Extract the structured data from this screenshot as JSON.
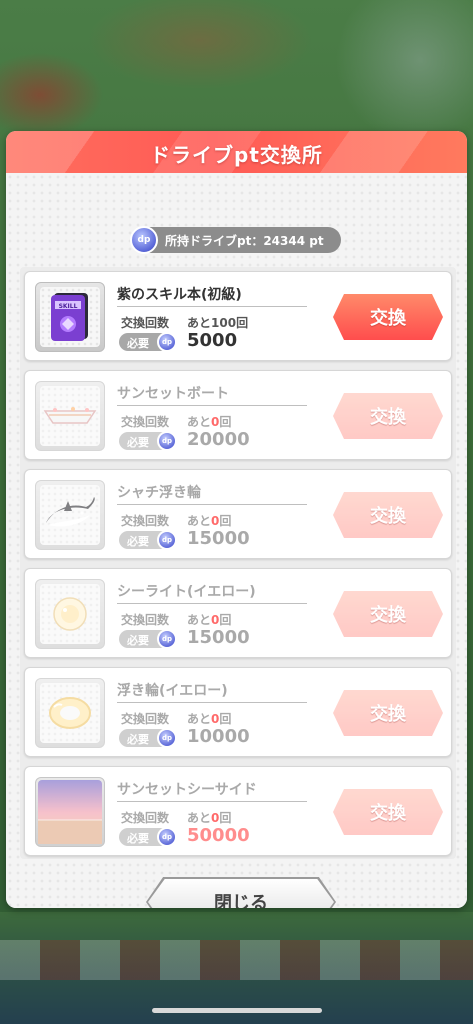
{
  "modal": {
    "title": "ドライブpt交換所",
    "points_label": "所持ドライブpt：24344 pt",
    "close_label": "閉じる"
  },
  "common": {
    "count_label": "交換回数",
    "required_label": "必要",
    "exchange_label": "交換",
    "coin_icon_text": "dp"
  },
  "items": [
    {
      "name": "紫のスキル本(初級)",
      "remaining_prefix": "あと",
      "remaining_num": "100",
      "remaining_suffix": "回",
      "cost": "5000",
      "icon": "purple-skill-book-icon",
      "enabled": true
    },
    {
      "name": "サンセットボート",
      "remaining_prefix": "あと",
      "remaining_num": "0",
      "remaining_suffix": "回",
      "cost": "20000",
      "icon": "sunset-boat-icon",
      "enabled": false
    },
    {
      "name": "シャチ浮き輪",
      "remaining_prefix": "あと",
      "remaining_num": "0",
      "remaining_suffix": "回",
      "cost": "15000",
      "icon": "orca-float-icon",
      "enabled": false
    },
    {
      "name": "シーライト(イエロー)",
      "remaining_prefix": "あと",
      "remaining_num": "0",
      "remaining_suffix": "回",
      "cost": "15000",
      "icon": "sea-light-icon",
      "enabled": false
    },
    {
      "name": "浮き輪(イエロー)",
      "remaining_prefix": "あと",
      "remaining_num": "0",
      "remaining_suffix": "回",
      "cost": "10000",
      "icon": "swim-ring-icon",
      "enabled": false
    },
    {
      "name": "サンセットシーサイド",
      "remaining_prefix": "あと",
      "remaining_num": "0",
      "remaining_suffix": "回",
      "cost": "50000",
      "icon": "sunset-seaside-icon",
      "enabled": false
    }
  ],
  "colors": {
    "header": "#ff5a55",
    "exchange_enabled": "#ff4d4d",
    "zero_count": "#ff5b5b"
  }
}
